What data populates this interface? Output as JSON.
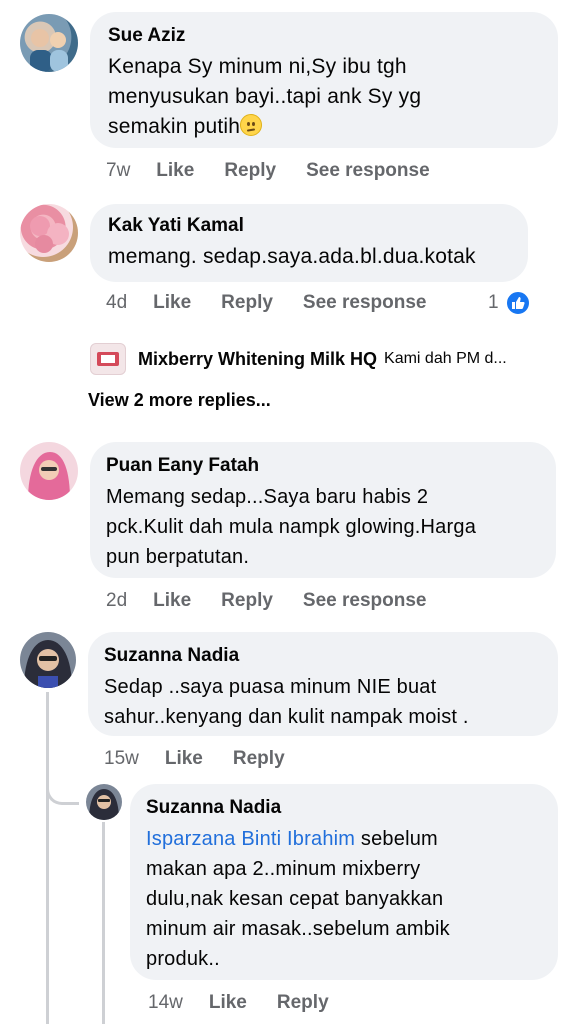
{
  "comments": [
    {
      "author": "Sue Aziz",
      "text_lines": [
        "Kenapa Sy minum ni,Sy ibu tgh",
        "menyusukan bayi..tapi ank Sy yg",
        "semakin putih"
      ],
      "time": "7w",
      "actions": [
        "Like",
        "Reply",
        "See response"
      ]
    },
    {
      "author": "Kak Yati Kamal",
      "text_lines": [
        "memang. sedap.saya.ada.bl.dua.kotak"
      ],
      "time": "4d",
      "actions": [
        "Like",
        "Reply",
        "See response"
      ],
      "like_count": "1",
      "reply_preview": {
        "author": "Mixberry Whitening Milk HQ",
        "snippet": "Kami dah PM d..."
      },
      "more_replies": "View 2 more replies..."
    },
    {
      "author": "Puan Eany Fatah",
      "text_lines": [
        "Memang sedap...Saya baru habis 2",
        "pck.Kulit dah mula nampk glowing.Harga",
        "pun berpatutan."
      ],
      "time": "2d",
      "actions": [
        "Like",
        "Reply",
        "See response"
      ]
    },
    {
      "author": "Suzanna Nadia",
      "text_lines": [
        "Sedap ..saya puasa minum NIE buat",
        "sahur..kenyang dan kulit nampak moist ."
      ],
      "time": "15w",
      "actions": [
        "Like",
        "Reply"
      ]
    }
  ],
  "reply": {
    "author": "Suzanna Nadia",
    "mention": "Isparzana Binti Ibrahim",
    "text_first_line_rest": " sebelum",
    "text_lines": [
      "makan apa 2..minum mixberry",
      "dulu,nak kesan cepat banyakkan",
      "minum air masak..sebelum ambik",
      "produk.."
    ],
    "time": "14w",
    "actions": [
      "Like",
      "Reply"
    ]
  },
  "colors": {
    "bubble": "#f0f2f5",
    "meta_text": "#65676b",
    "mention": "#216fdb",
    "like_blue": "#1877f2"
  },
  "icons": [
    "confused-emoji-icon",
    "like-thumb-icon"
  ]
}
